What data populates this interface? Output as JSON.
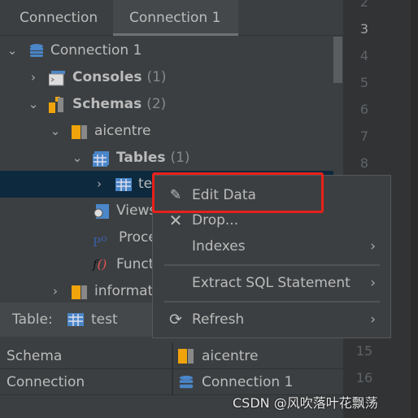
{
  "tabs": [
    {
      "label": "Connection"
    },
    {
      "label": "Connection 1",
      "active": true
    }
  ],
  "tree": {
    "connection": "Connection 1",
    "consoles": {
      "label": "Consoles",
      "count": "(1)"
    },
    "schemas": {
      "label": "Schemas",
      "count": "(2)"
    },
    "aicentre": "aicentre",
    "tables": {
      "label": "Tables",
      "count": "(1)"
    },
    "test": "te",
    "views": "Views",
    "procedures": "Proce",
    "functions": "Funct",
    "information": "informat"
  },
  "line_numbers": [
    "2",
    "3",
    "4",
    "5",
    "6",
    "7",
    "8",
    "15",
    "16"
  ],
  "current_line": "3",
  "info": {
    "header_label": "Table:",
    "header_value": "test",
    "rows": [
      {
        "key": "Schema",
        "value": "aicentre"
      },
      {
        "key": "Connection",
        "value": "Connection 1"
      }
    ]
  },
  "menu": {
    "items": [
      {
        "label": "Edit Data",
        "icon": "edit-data-icon"
      },
      {
        "label": "Drop...",
        "icon": "close-icon"
      },
      {
        "label": "Indexes",
        "submenu": true
      },
      {
        "label": "Extract SQL Statement",
        "submenu": true
      },
      {
        "label": "Refresh",
        "icon": "refresh-icon",
        "submenu": true
      }
    ]
  },
  "colors": {
    "highlight_box": "#e8201a",
    "selection": "#0d293e",
    "schema_icon": "#f0a30a",
    "db_icon": "#4a86c8"
  },
  "watermark": "CSDN @风吹落叶花飘荡"
}
